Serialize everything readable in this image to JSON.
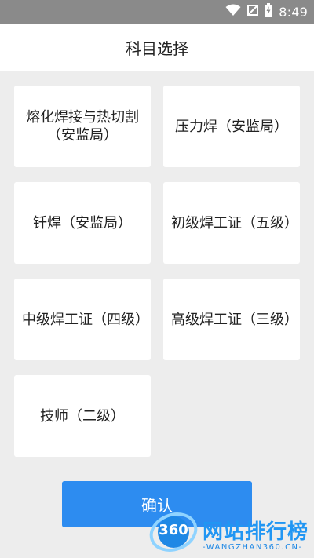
{
  "status_bar": {
    "time": "8:49"
  },
  "header": {
    "title": "科目选择"
  },
  "subjects": [
    {
      "label": "熔化焊接与热切割（安监局）"
    },
    {
      "label": "压力焊（安监局）"
    },
    {
      "label": "钎焊（安监局）"
    },
    {
      "label": "初级焊工证（五级）"
    },
    {
      "label": "中级焊工证（四级）"
    },
    {
      "label": "高级焊工证（三级）"
    },
    {
      "label": "技师（二级）"
    }
  ],
  "confirm_label": "确认",
  "watermark": {
    "badge": "360",
    "text": "网站排行榜",
    "sub": "-WANGZHAN360.CN-"
  },
  "colors": {
    "accent": "#2d8cf0",
    "status_bar": "#8a8a8a",
    "background": "#ededed"
  }
}
